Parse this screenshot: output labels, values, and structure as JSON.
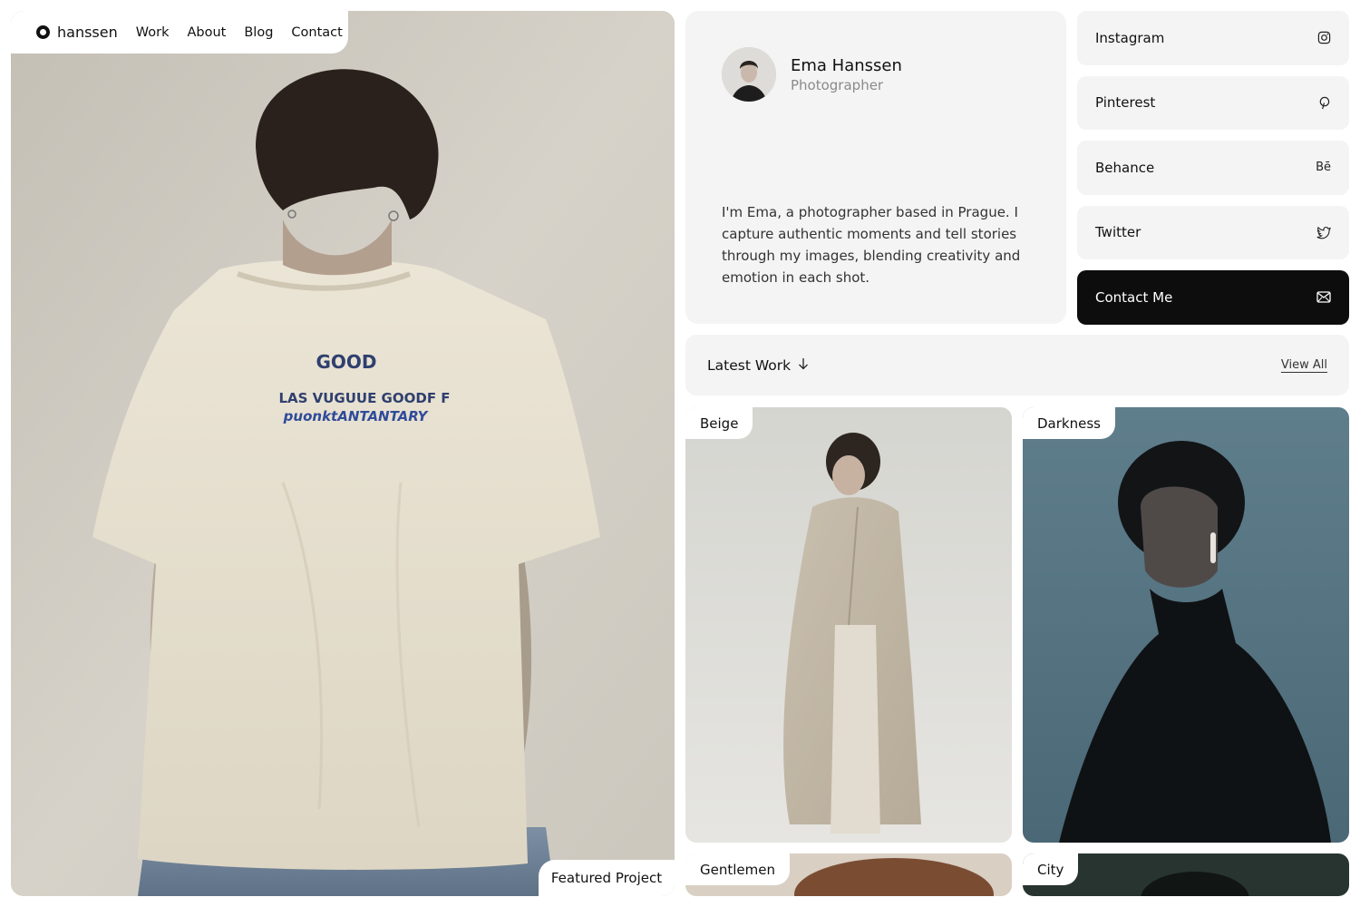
{
  "nav": {
    "brand": "hanssen",
    "links": [
      "Work",
      "About",
      "Blog",
      "Contact"
    ]
  },
  "hero": {
    "featured_label": "Featured Project",
    "shirt_print": {
      "line1": "GOOD",
      "line2": "LAS VUGUUE GOODF F",
      "line3": "puonktANTANTARY"
    }
  },
  "profile": {
    "name": "Ema Hanssen",
    "role": "Photographer",
    "bio": "I'm Ema, a photographer based in Prague. I capture authentic moments and tell stories through my images, blending creativity and emotion in each shot."
  },
  "socials": [
    {
      "label": "Instagram",
      "icon": "instagram-icon"
    },
    {
      "label": "Pinterest",
      "icon": "pinterest-icon"
    },
    {
      "label": "Behance",
      "icon": "behance-icon",
      "glyph": "Bē"
    },
    {
      "label": "Twitter",
      "icon": "twitter-icon"
    },
    {
      "label": "Contact Me",
      "icon": "mail-icon"
    }
  ],
  "latest_work": {
    "title": "Latest Work",
    "view_all": "View All"
  },
  "works": [
    {
      "label": "Beige"
    },
    {
      "label": "Darkness"
    },
    {
      "label": "Gentlemen"
    },
    {
      "label": "City"
    }
  ],
  "colors": {
    "card_bg": "#f4f4f4",
    "dark_button": "#0d0d0d",
    "muted_text": "#8a8a8a"
  }
}
